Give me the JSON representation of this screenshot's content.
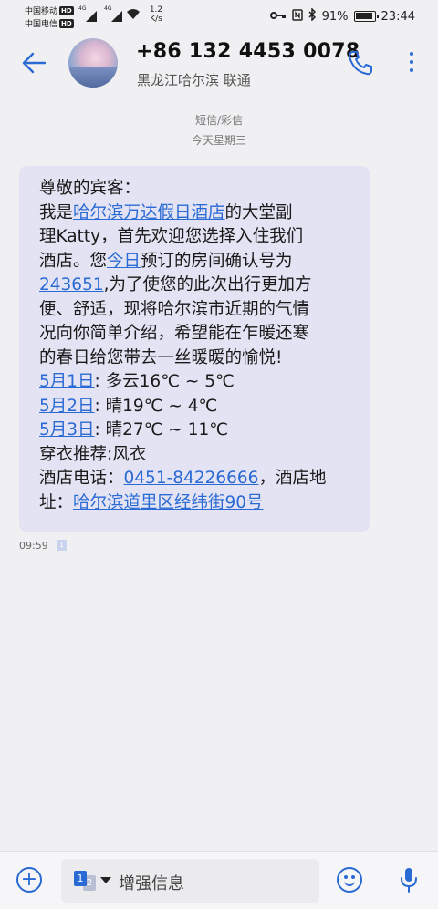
{
  "status_bar": {
    "carrier1": "中国移动",
    "carrier2": "中国电信",
    "hd": "HD",
    "net1": "4G",
    "net2": "4G",
    "speed_value": "1.2",
    "speed_unit": "K/s",
    "battery": "91%",
    "time": "23:44"
  },
  "header": {
    "contact_number": "+86 132 4453 0078",
    "contact_location": "黑龙江哈尔滨 联通"
  },
  "conversation": {
    "message_type": "短信/彩信",
    "date": "今天星期三"
  },
  "message": {
    "l1": "尊敬的宾客：",
    "l2a": "我是",
    "l2_link": "哈尔滨万达假日酒店",
    "l2b": "的大堂副",
    "l3": "理Katty，首先欢迎您选择入住我们",
    "l4a": "酒店。您",
    "l4_link": "今日",
    "l4b": "预订的房间确认号为",
    "l5_link": "243651",
    "l5b": ",为了使您的此次出行更加方",
    "l6": "便、舒适，现将哈尔滨市近期的气情",
    "l7": "况向你简单介绍，希望能在乍暖还寒",
    "l8": "的春日给您带去一丝暖暖的愉悦!",
    "l9_link": "5月1日",
    "l9b": ": 多云16℃ ~ 5℃",
    "l10_link": "5月2日",
    "l10b": ": 晴19℃ ~ 4℃",
    "l11_link": "5月3日",
    "l11b": ": 晴27℃ ~ 11℃",
    "l12": "穿衣推荐:风衣",
    "l13a": "酒店电话：",
    "l13_link": "0451-84226666",
    "l13b": "，酒店地",
    "l14a": "址：",
    "l14_link": "哈尔滨道里区经纬街90号",
    "time": "09:59",
    "sim_badge": "1"
  },
  "input_bar": {
    "sim_primary": "1",
    "sim_secondary": "2",
    "placeholder": "增强信息"
  },
  "colors": {
    "accent": "#2a6ad4",
    "bubble": "#e3e3f3",
    "background": "#f0f0f2"
  },
  "icons": [
    "back-arrow-icon",
    "phone-icon",
    "more-vertical-icon",
    "add-icon",
    "sim-card-icon",
    "emoji-icon",
    "microphone-icon",
    "key-icon",
    "nfc-icon",
    "bluetooth-icon",
    "battery-icon",
    "wifi-icon",
    "signal-icon"
  ]
}
